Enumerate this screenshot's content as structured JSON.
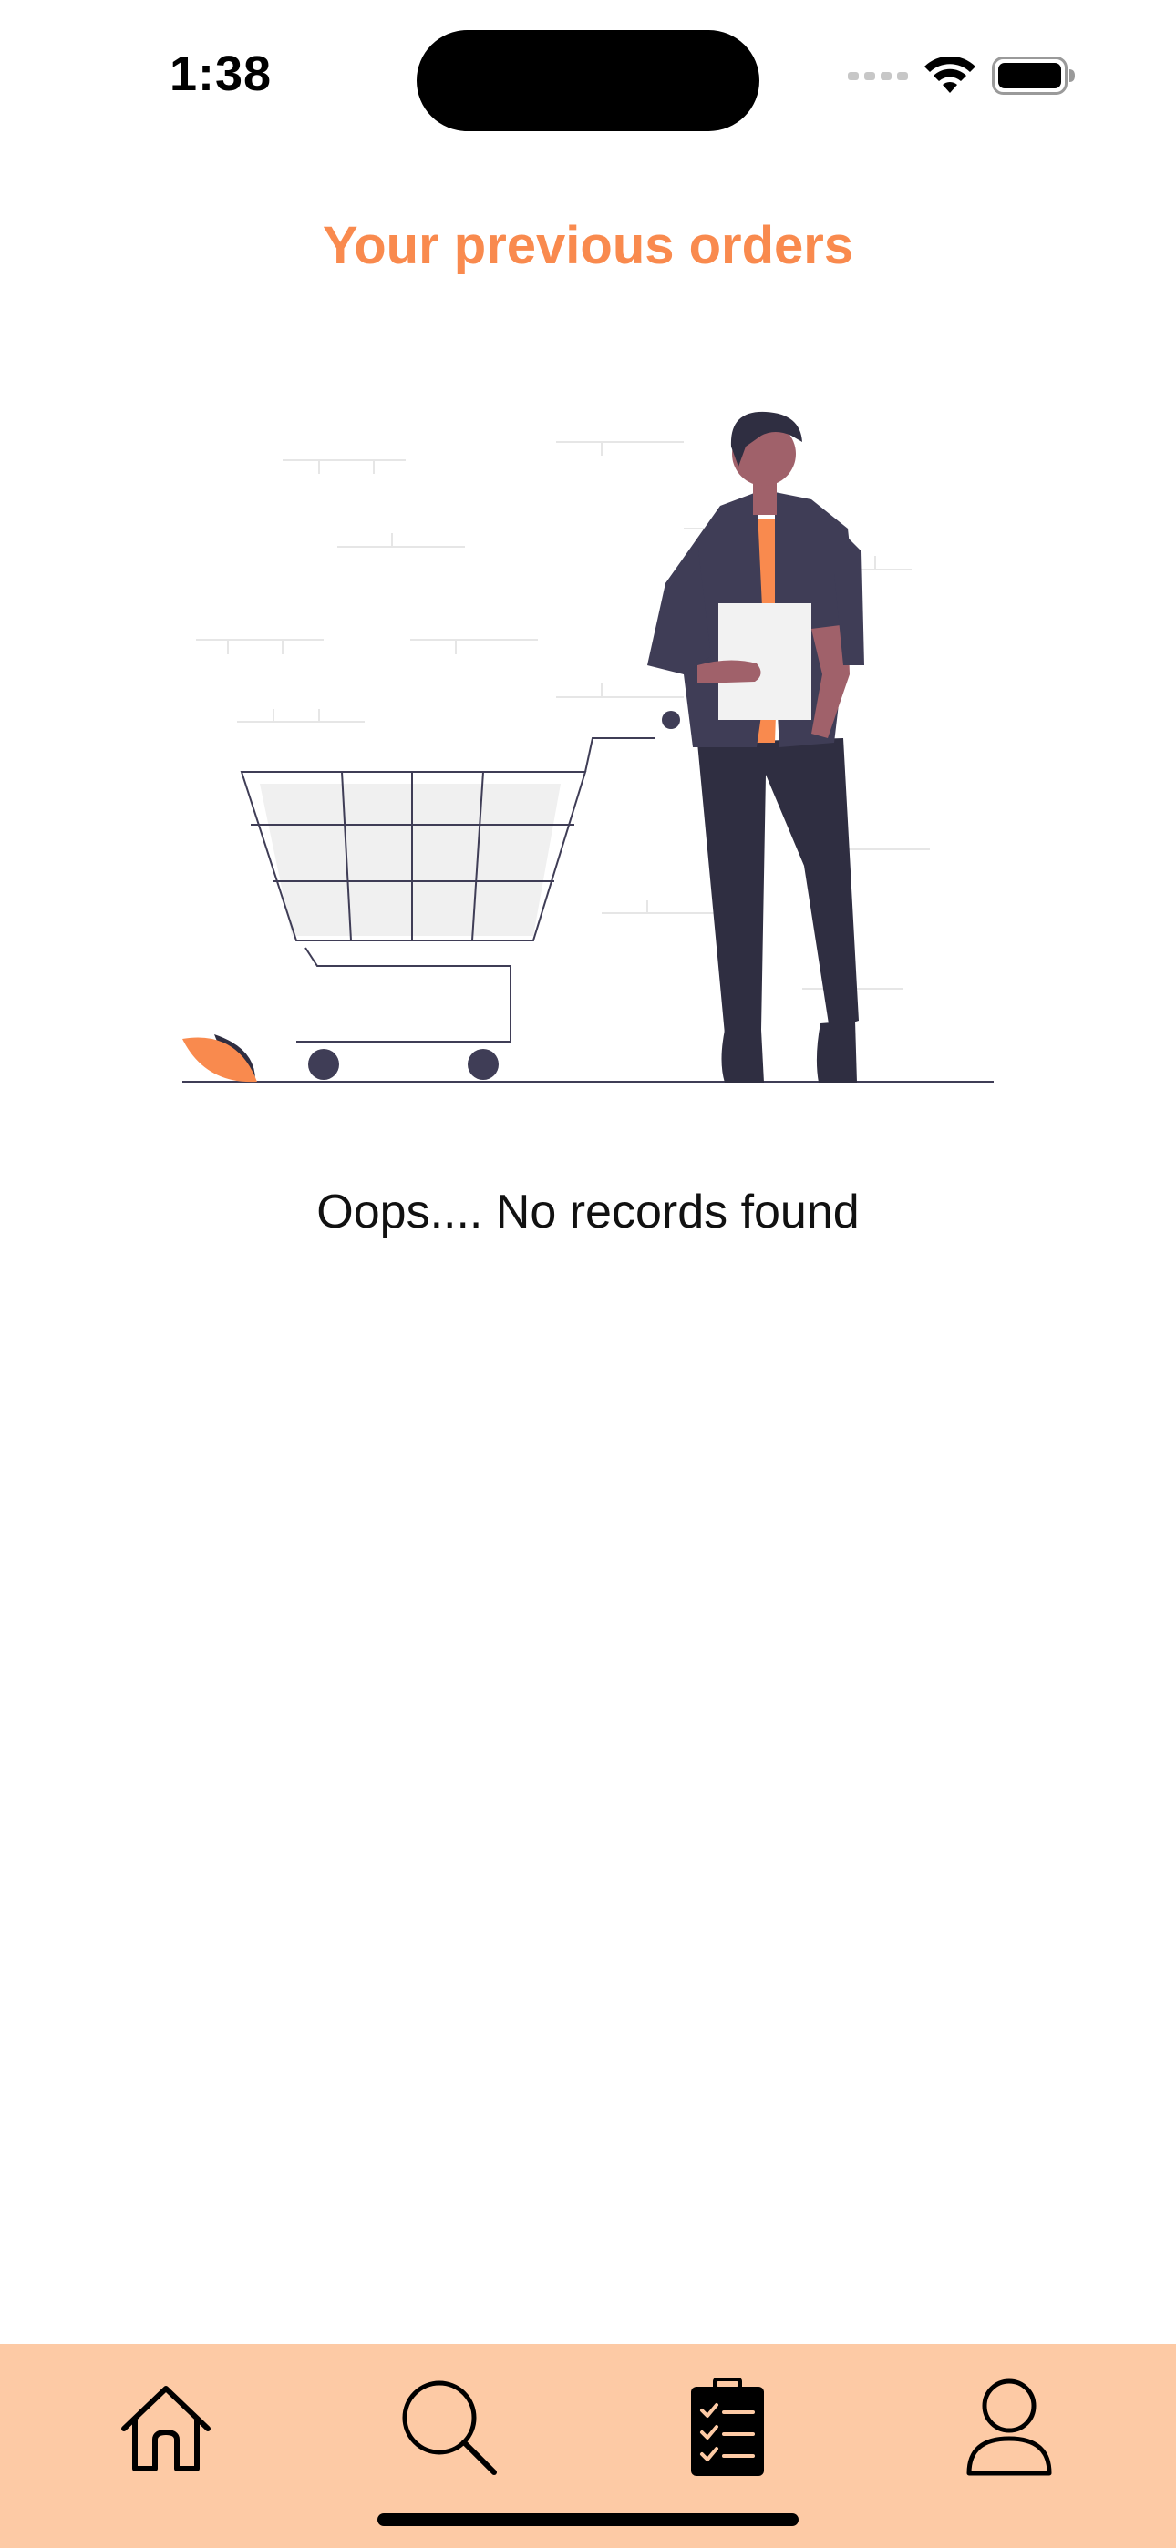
{
  "status_bar": {
    "time": "1:38"
  },
  "header": {
    "title": "Your previous orders"
  },
  "empty_state": {
    "illustration": "person-with-shopping-cart",
    "message": "Oops.... No records found"
  },
  "tab_bar": {
    "tabs": [
      {
        "icon": "home-icon",
        "active": false
      },
      {
        "icon": "search-icon",
        "active": false
      },
      {
        "icon": "orders-clipboard-icon",
        "active": true
      },
      {
        "icon": "profile-icon",
        "active": false
      }
    ]
  },
  "colors": {
    "accent": "#F98A4E",
    "tab_bar_bg": "#FDCAA5",
    "dark": "#2F2E41",
    "text": "#111111"
  }
}
